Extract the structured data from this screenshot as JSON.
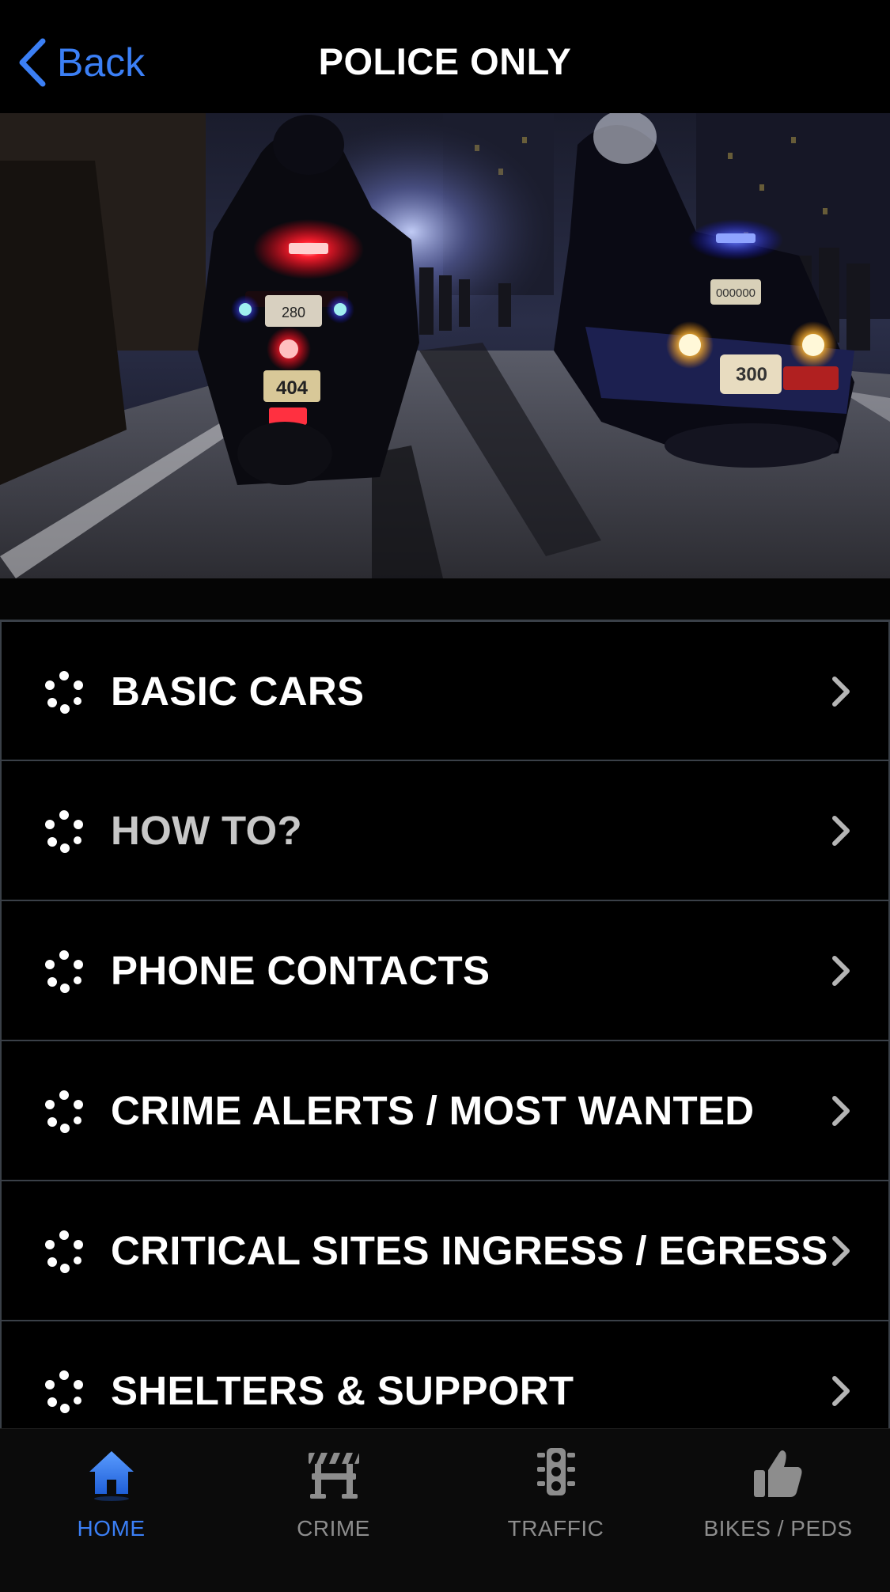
{
  "header": {
    "back_label": "Back",
    "title": "POLICE ONLY"
  },
  "hero": {
    "plate_left_top": "280",
    "plate_left_bottom": "404",
    "plate_right_top": "000000",
    "plate_right_bottom": "300"
  },
  "menu": {
    "items": [
      {
        "label": "BASIC CARS"
      },
      {
        "label": "HOW TO?"
      },
      {
        "label": "PHONE CONTACTS"
      },
      {
        "label": "CRIME ALERTS / MOST WANTED"
      },
      {
        "label": "CRITICAL SITES INGRESS / EGRESS"
      },
      {
        "label": "SHELTERS & SUPPORT"
      }
    ]
  },
  "tabbar": {
    "tabs": [
      {
        "label": "HOME",
        "icon": "home-icon",
        "active": true
      },
      {
        "label": "CRIME",
        "icon": "barricade-icon",
        "active": false
      },
      {
        "label": "TRAFFIC",
        "icon": "traffic-light-icon",
        "active": false
      },
      {
        "label": "BIKES / PEDS",
        "icon": "thumbs-up-icon",
        "active": false
      }
    ]
  },
  "colors": {
    "accent": "#3b7ff5",
    "background": "#000000",
    "divider": "#3a4048",
    "inactive_tab": "#8d8d8d"
  }
}
